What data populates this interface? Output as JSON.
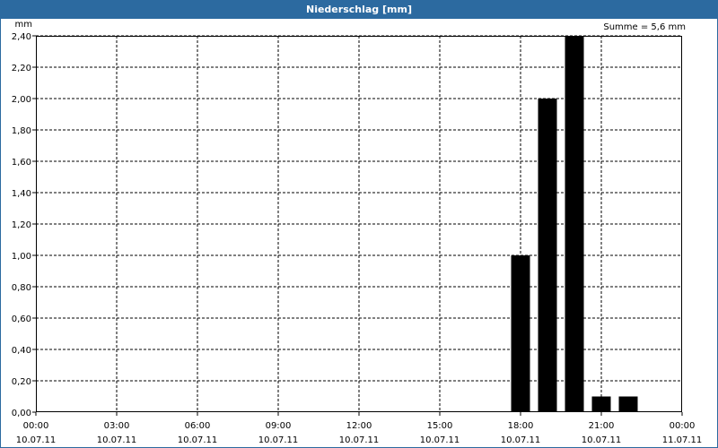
{
  "window": {
    "title": "Niederschlag [mm]"
  },
  "summary": "Summe = 5,6 mm",
  "chart_data": {
    "type": "bar",
    "title": "Niederschlag [mm]",
    "ylabel": "mm",
    "ylim": [
      0,
      2.4
    ],
    "yticks": [
      "0,00",
      "0,20",
      "0,40",
      "0,60",
      "0,80",
      "1,00",
      "1,20",
      "1,40",
      "1,60",
      "1,80",
      "2,00",
      "2,20",
      "2,40"
    ],
    "xlim_hours": [
      0,
      24
    ],
    "xticks": [
      {
        "time": "00:00",
        "date": "10.07.11"
      },
      {
        "time": "03:00",
        "date": "10.07.11"
      },
      {
        "time": "06:00",
        "date": "10.07.11"
      },
      {
        "time": "09:00",
        "date": "10.07.11"
      },
      {
        "time": "12:00",
        "date": "10.07.11"
      },
      {
        "time": "15:00",
        "date": "10.07.11"
      },
      {
        "time": "18:00",
        "date": "10.07.11"
      },
      {
        "time": "21:00",
        "date": "10.07.11"
      },
      {
        "time": "00:00",
        "date": "11.07.11"
      }
    ],
    "bars": [
      {
        "time": "18:00",
        "value": 1.0
      },
      {
        "time": "19:00",
        "value": 2.0
      },
      {
        "time": "20:00",
        "value": 2.4
      },
      {
        "time": "21:00",
        "value": 0.1
      },
      {
        "time": "22:00",
        "value": 0.1
      }
    ],
    "bar_color": "#000000",
    "grid": true
  }
}
